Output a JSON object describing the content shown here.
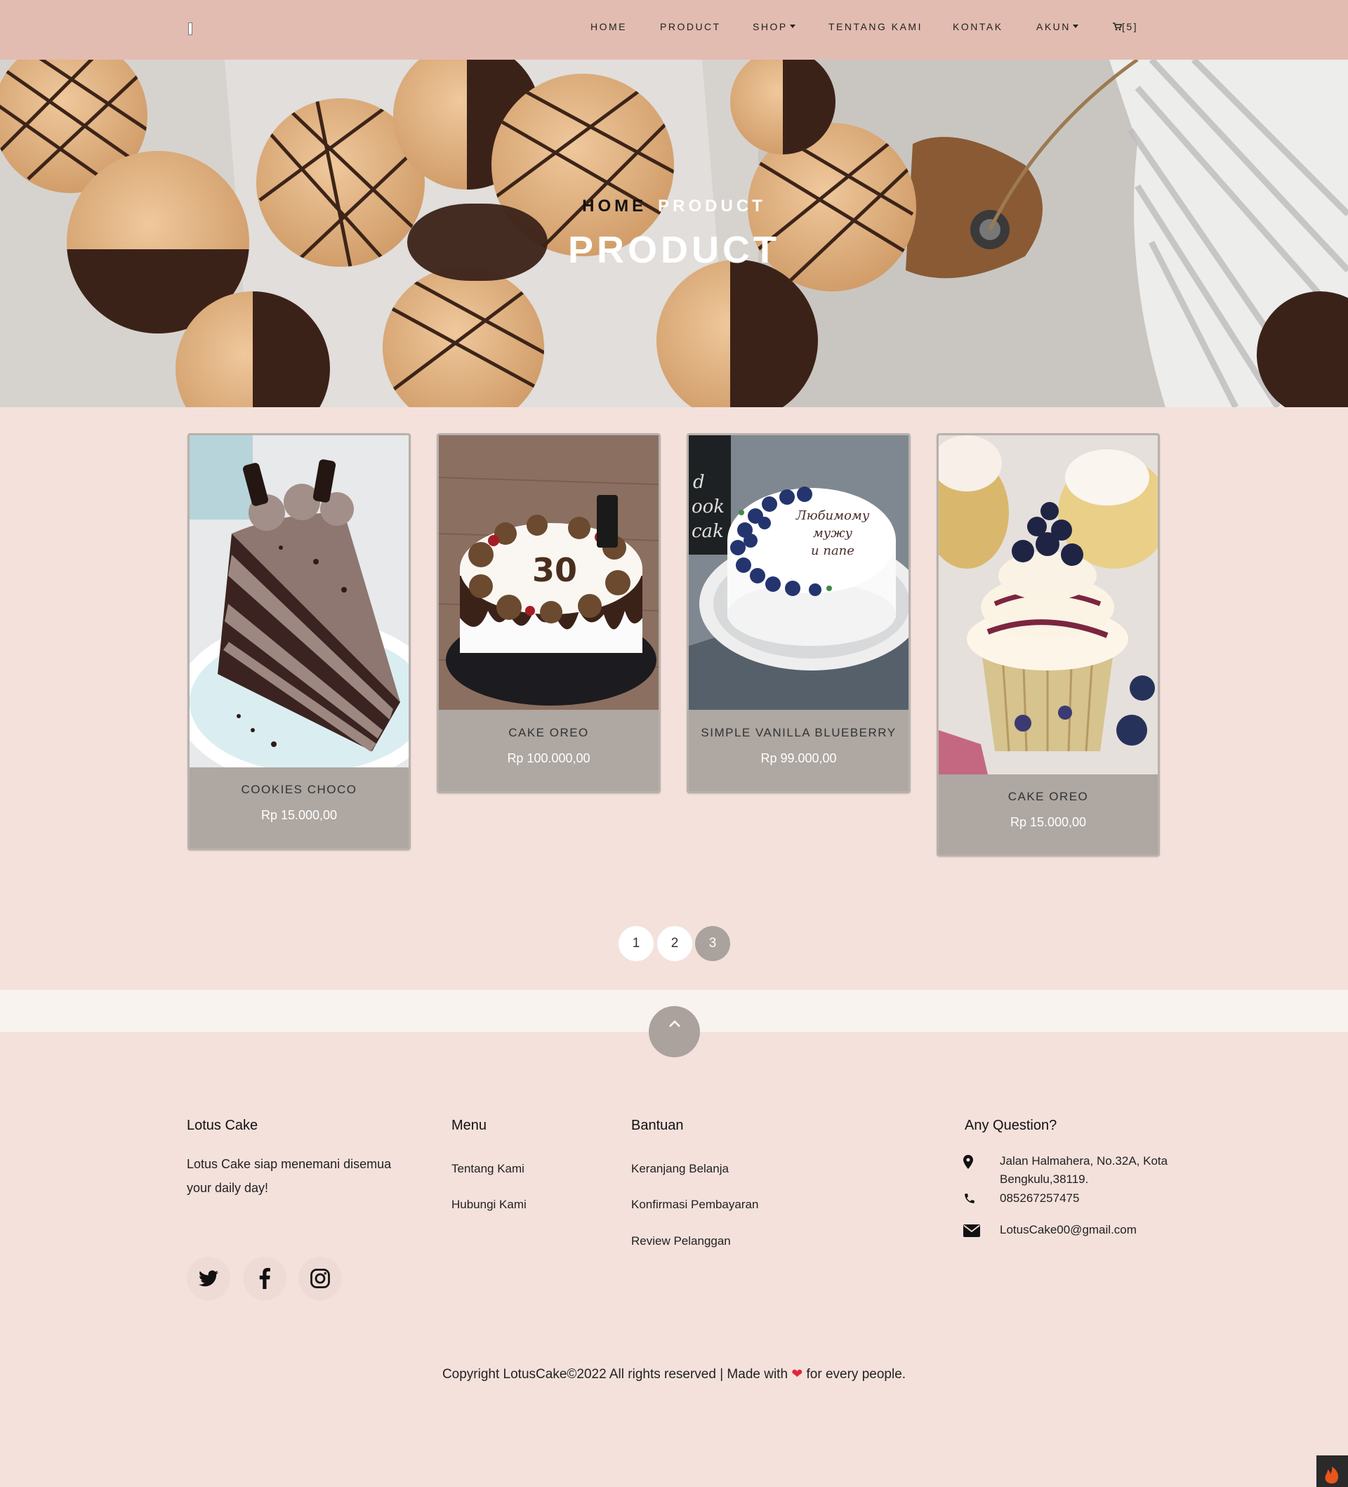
{
  "nav": {
    "items": [
      {
        "label": "HOME"
      },
      {
        "label": "PRODUCT"
      },
      {
        "label": "SHOP"
      },
      {
        "label": "TENTANG KAMI"
      },
      {
        "label": "KONTAK"
      },
      {
        "label": "AKUN"
      }
    ],
    "cart_label": "[5]"
  },
  "hero": {
    "breadcrumb_home": "HOME",
    "breadcrumb_current": "PRODUCT",
    "title": "PRODUCT"
  },
  "products": [
    {
      "name": "COOKIES CHOCO",
      "price": "Rp 15.000,00"
    },
    {
      "name": "CAKE OREO",
      "price": "Rp 100.000,00"
    },
    {
      "name": "SIMPLE VANILLA BLUEBERRY",
      "price": "Rp 99.000,00"
    },
    {
      "name": "CAKE OREO",
      "price": "Rp 15.000,00"
    }
  ],
  "pagination": {
    "pages": [
      "1",
      "2",
      "3"
    ],
    "current": "3"
  },
  "footer": {
    "about_title": "Lotus Cake",
    "about_text": "Lotus Cake siap menemani disemua your daily day!",
    "menu_title": "Menu",
    "menu_links": [
      "Tentang Kami",
      "Hubungi Kami"
    ],
    "help_title": "Bantuan",
    "help_links": [
      "Keranjang Belanja",
      "Konfirmasi Pembayaran",
      "Review Pelanggan"
    ],
    "contact_title": "Any Question?",
    "address": "Jalan Halmahera, No.32A, Kota Bengkulu,38119.",
    "phone": "085267257475",
    "email": "LotusCake00@gmail.com",
    "social": [
      "twitter-icon",
      "facebook-icon",
      "instagram-icon"
    ],
    "copyright_before": "Copyright LotusCake©2022 All rights reserved | Made with",
    "copyright_after": "for every people."
  },
  "colors": {
    "navbar": "#e2bcb0",
    "page_bg": "#f4e1dc",
    "card_bg": "#aea7a2",
    "active_page": "#aaa29c",
    "heart": "#e0263a"
  }
}
